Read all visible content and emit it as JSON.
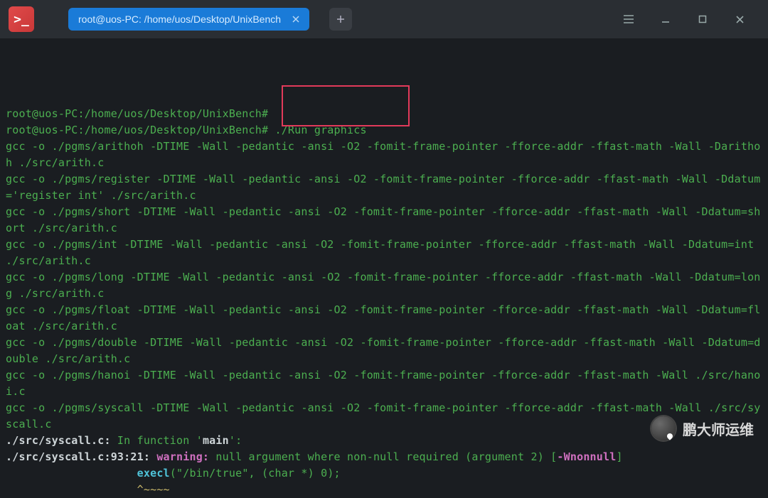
{
  "titlebar": {
    "app_icon_label": ">_",
    "tab_title": "root@uos-PC: /home/uos/Desktop/UnixBench",
    "new_tab_label": "＋"
  },
  "terminal": {
    "prompt1": "root@uos-PC:/home/uos/Desktop/UnixBench#",
    "prompt2": "root@uos-PC:/home/uos/Desktop/UnixBench#",
    "cmd": " ./Run graphics",
    "l1": "gcc -o ./pgms/arithoh -DTIME -Wall -pedantic -ansi -O2 -fomit-frame-pointer -fforce-addr -ffast-math -Wall -Darithoh ./src/arith.c",
    "l2": "gcc -o ./pgms/register -DTIME -Wall -pedantic -ansi -O2 -fomit-frame-pointer -fforce-addr -ffast-math -Wall -Ddatum='register int' ./src/arith.c",
    "l3": "gcc -o ./pgms/short -DTIME -Wall -pedantic -ansi -O2 -fomit-frame-pointer -fforce-addr -ffast-math -Wall -Ddatum=short ./src/arith.c",
    "l4": "gcc -o ./pgms/int -DTIME -Wall -pedantic -ansi -O2 -fomit-frame-pointer -fforce-addr -ffast-math -Wall -Ddatum=int ./src/arith.c",
    "l5": "gcc -o ./pgms/long -DTIME -Wall -pedantic -ansi -O2 -fomit-frame-pointer -fforce-addr -ffast-math -Wall -Ddatum=long ./src/arith.c",
    "l6": "gcc -o ./pgms/float -DTIME -Wall -pedantic -ansi -O2 -fomit-frame-pointer -fforce-addr -ffast-math -Wall -Ddatum=float ./src/arith.c",
    "l7": "gcc -o ./pgms/double -DTIME -Wall -pedantic -ansi -O2 -fomit-frame-pointer -fforce-addr -ffast-math -Wall -Ddatum=double ./src/arith.c",
    "l8": "gcc -o ./pgms/hanoi -DTIME -Wall -pedantic -ansi -O2 -fomit-frame-pointer -fforce-addr -ffast-math -Wall ./src/hanoi.c",
    "l9": "gcc -o ./pgms/syscall -DTIME -Wall -pedantic -ansi -O2 -fomit-frame-pointer -fforce-addr -ffast-math -Wall ./src/syscall.c",
    "warn1_file": "./src/syscall.c:",
    "warn1_rest": " In function '",
    "warn1_main": "main",
    "warn1_end": "':",
    "warn2_loc": "./src/syscall.c:93:21: ",
    "warn2_tag": "warning:",
    "warn2_msg": " null argument where non-null required (argument 2) [",
    "warn2_flag": "-Wnonnull",
    "warn2_close": "]",
    "code_indent": "                    ",
    "code_execl": "execl",
    "code_args": "(\"/bin/true\", (char *) 0);",
    "caret_indent": "                    ",
    "caret": "^~~~~"
  },
  "watermark": {
    "text": "鹏大师运维"
  }
}
